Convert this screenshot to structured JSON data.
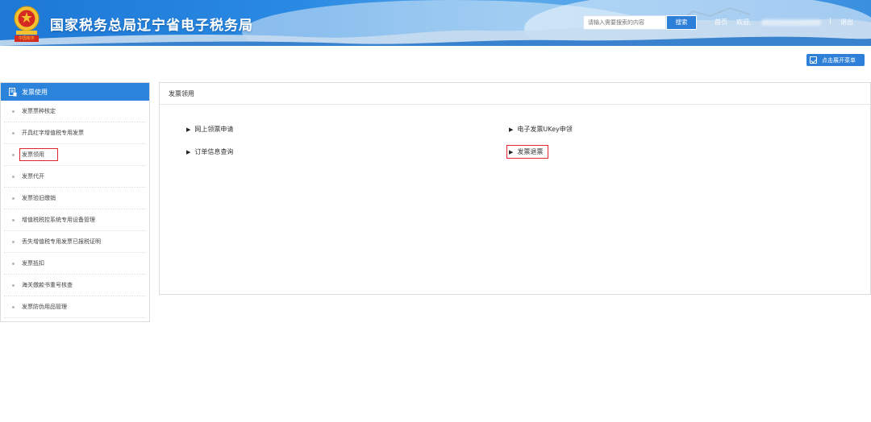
{
  "header": {
    "title": "国家税务总局辽宁省电子税务局",
    "emblem_label": "中国税务",
    "search_placeholder": "请输入需要搜索的内容",
    "search_button": "搜索",
    "home_link": "首页",
    "welcome": "欢迎,",
    "divider": "|",
    "logout": "退出",
    "colors": {
      "primary": "#2c83db",
      "emblem_red": "#d42a21",
      "gold": "#f2c230"
    }
  },
  "toolbar": {
    "expand_menu_label": "点击展开菜单",
    "expand_menu_icon": "checkbox-icon"
  },
  "sidebar": {
    "header_label": "发票使用",
    "header_icon": "document-icon",
    "items": [
      {
        "label": "发票票种核定"
      },
      {
        "label": "开具红字增值税专用发票"
      },
      {
        "label": "发票领用",
        "active": true
      },
      {
        "label": "发票代开"
      },
      {
        "label": "发票验旧缴销"
      },
      {
        "label": "增值税税控系统专用设备管理"
      },
      {
        "label": "丢失增值税专用发票已报税证明"
      },
      {
        "label": "发票抵扣"
      },
      {
        "label": "海关缴款书重号核查"
      },
      {
        "label": "发票防伪用品管理"
      }
    ]
  },
  "main": {
    "panel_title": "发票领用",
    "links": [
      {
        "label": "网上领票申请"
      },
      {
        "label": "电子发票UKey申领"
      },
      {
        "label": "订单信息查询"
      },
      {
        "label": "发票退票",
        "highlighted": true
      }
    ],
    "arrow_glyph": "▶"
  }
}
